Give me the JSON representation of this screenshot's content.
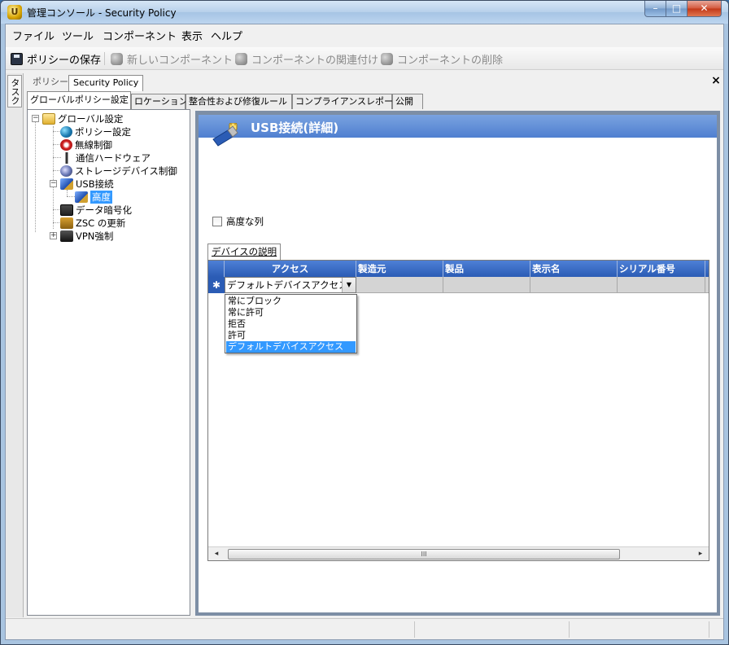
{
  "window": {
    "title": "管理コンソール - Security Policy",
    "app_glyph": "U",
    "min_glyph": "–",
    "max_glyph": "□",
    "close_glyph": "✕"
  },
  "menu": [
    "ファイル",
    "ツール",
    "コンポーネント",
    "表示",
    "ヘルプ"
  ],
  "toolbar": {
    "save_policy": "ポリシーの保存",
    "new_component": "新しいコンポーネント",
    "associate_component": "コンポーネントの関連付け",
    "delete_component": "コンポーネントの削除"
  },
  "task_tab": "タスク",
  "doc_tabs": {
    "policy": "ポリシー",
    "security_policy": "Security Policy",
    "close": "×"
  },
  "sub_tabs": [
    "グローバルポリシー設定",
    "ロケーション",
    "整合性および修復ルール",
    "コンプライアンスレポート",
    "公開"
  ],
  "tree": {
    "root": "グローバル設定",
    "items": [
      "ポリシー設定",
      "無線制御",
      "通信ハードウェア",
      "ストレージデバイス制御",
      "USB接続",
      "高度",
      "データ暗号化",
      "ZSC の更新",
      "VPN強制"
    ],
    "expand_minus": "−",
    "expand_plus": "+"
  },
  "content": {
    "header_title": "USB接続(詳細)",
    "advanced_columns_label": "高度な列",
    "device_tab": "デバイスの説明",
    "grid": {
      "columns": [
        "アクセス",
        "製造元",
        "製品",
        "表示名",
        "シリアル番号"
      ],
      "new_row_marker": "✱",
      "combo_value": "デフォルトデバイスアクセス",
      "combo_arrow": "▼",
      "options": [
        "常にブロック",
        "常に許可",
        "拒否",
        "許可",
        "デフォルトデバイスアクセス"
      ],
      "selected_option": 4
    },
    "scroll": {
      "left": "◂",
      "right": "▸",
      "thumb": "III"
    }
  }
}
